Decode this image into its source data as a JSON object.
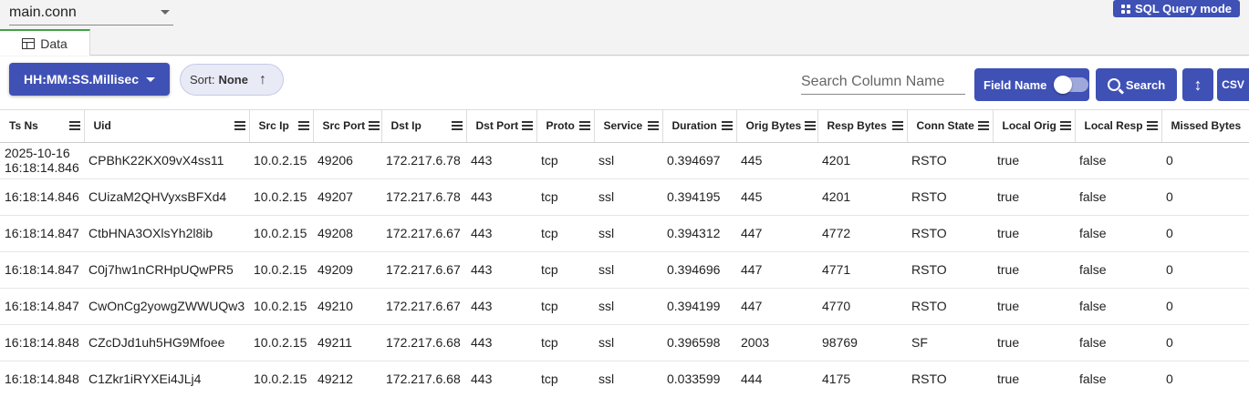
{
  "header": {
    "table_selector": "main.conn",
    "sql_mode_label": "SQL Query mode"
  },
  "tabs": [
    {
      "label": "Data"
    }
  ],
  "toolbar": {
    "time_format_label": "HH:MM:SS.Millisec",
    "sort_prefix": "Sort:",
    "sort_value": "None",
    "search_placeholder": "Search Column Name",
    "field_name_label": "Field Name",
    "search_label": "Search",
    "csv_label": "CSV"
  },
  "colors": {
    "primary": "#3f51b5",
    "tab_accent": "#43a047"
  },
  "table": {
    "columns": [
      "Ts Ns",
      "Uid",
      "Src Ip",
      "Src Port",
      "Dst Ip",
      "Dst Port",
      "Proto",
      "Service",
      "Duration",
      "Orig Bytes",
      "Resp Bytes",
      "Conn State",
      "Local Orig",
      "Local Resp",
      "Missed Bytes"
    ],
    "rows": [
      [
        "2025-10-16 16:18:14.846",
        "CPBhK22KX09vX4ss11",
        "10.0.2.15",
        "49206",
        "172.217.6.78",
        "443",
        "tcp",
        "ssl",
        "0.394697",
        "445",
        "4201",
        "RSTO",
        "true",
        "false",
        "0"
      ],
      [
        "16:18:14.846",
        "CUizaM2QHVyxsBFXd4",
        "10.0.2.15",
        "49207",
        "172.217.6.78",
        "443",
        "tcp",
        "ssl",
        "0.394195",
        "445",
        "4201",
        "RSTO",
        "true",
        "false",
        "0"
      ],
      [
        "16:18:14.847",
        "CtbHNA3OXlsYh2l8ib",
        "10.0.2.15",
        "49208",
        "172.217.6.67",
        "443",
        "tcp",
        "ssl",
        "0.394312",
        "447",
        "4772",
        "RSTO",
        "true",
        "false",
        "0"
      ],
      [
        "16:18:14.847",
        "C0j7hw1nCRHpUQwPR5",
        "10.0.2.15",
        "49209",
        "172.217.6.67",
        "443",
        "tcp",
        "ssl",
        "0.394696",
        "447",
        "4771",
        "RSTO",
        "true",
        "false",
        "0"
      ],
      [
        "16:18:14.847",
        "CwOnCg2yowgZWWUQw3",
        "10.0.2.15",
        "49210",
        "172.217.6.67",
        "443",
        "tcp",
        "ssl",
        "0.394199",
        "447",
        "4770",
        "RSTO",
        "true",
        "false",
        "0"
      ],
      [
        "16:18:14.848",
        "CZcDJd1uh5HG9Mfoee",
        "10.0.2.15",
        "49211",
        "172.217.6.68",
        "443",
        "tcp",
        "ssl",
        "0.396598",
        "2003",
        "98769",
        "SF",
        "true",
        "false",
        "0"
      ],
      [
        "16:18:14.848",
        "C1Zkr1iRYXEi4JLj4",
        "10.0.2.15",
        "49212",
        "172.217.6.68",
        "443",
        "tcp",
        "ssl",
        "0.033599",
        "444",
        "4175",
        "RSTO",
        "true",
        "false",
        "0"
      ]
    ]
  }
}
